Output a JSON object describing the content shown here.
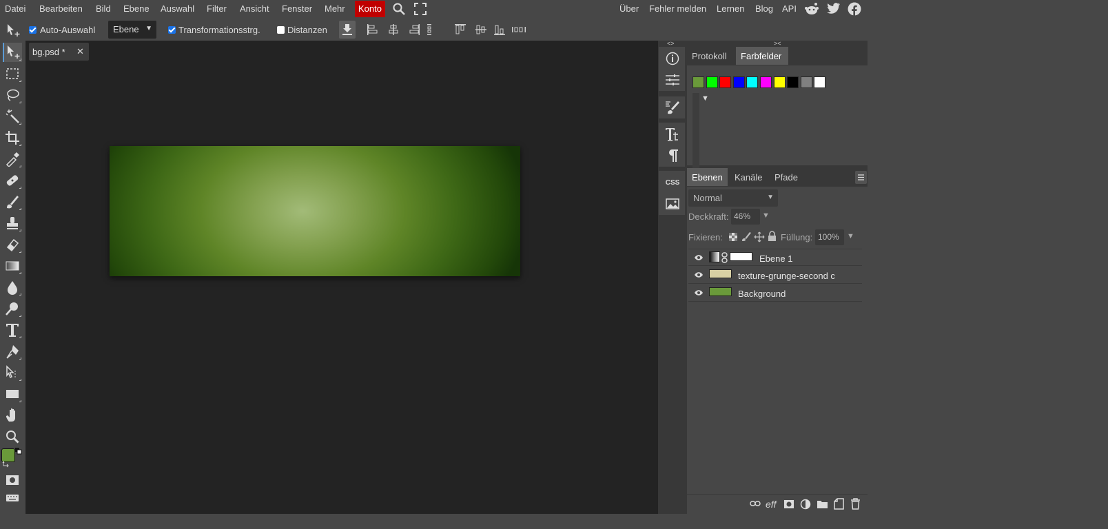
{
  "menu": {
    "items": [
      "Datei",
      "Bearbeiten",
      "Bild",
      "Ebene",
      "Auswahl",
      "Filter",
      "Ansicht",
      "Fenster",
      "Mehr"
    ],
    "konto": "Konto",
    "right": [
      "Über",
      "Fehler melden",
      "Lernen",
      "Blog",
      "API"
    ]
  },
  "options": {
    "auto_select_label": "Auto-Auswahl",
    "auto_select_checked": true,
    "target_value": "Ebene",
    "transform_label": "Transformationsstrg.",
    "transform_checked": true,
    "distances_label": "Distanzen",
    "distances_checked": false
  },
  "document": {
    "tab_title": "bg.psd *",
    "close_glyph": "✕"
  },
  "colors": {
    "foreground": "#6a9a3a",
    "background": "#ffffff",
    "konto_bg": "#c00000",
    "accent": "#5b9bd5"
  },
  "history_panel": {
    "tabs": [
      "Protokoll",
      "Farbfelder"
    ],
    "active_tab": "Farbfelder",
    "swatches": [
      "#6a9a3a",
      "#00ff00",
      "#ff0000",
      "#0000ff",
      "#00ffff",
      "#ff00ff",
      "#ffff00",
      "#000000",
      "#808080",
      "#ffffff"
    ],
    "collapse_left": "<>",
    "collapse_right": "><"
  },
  "layers_panel": {
    "tabs": [
      "Ebenen",
      "Kanäle",
      "Pfade"
    ],
    "active_tab": "Ebenen",
    "blend_mode": "Normal",
    "opacity_label": "Deckkraft:",
    "opacity_value": "46%",
    "lock_label": "Fixieren:",
    "fill_label": "Füllung:",
    "fill_value": "100%",
    "layers": [
      {
        "name": "Ebene 1",
        "thumb": "gradient-mask"
      },
      {
        "name": "texture-grunge-second c",
        "thumb": "#d8d0a4"
      },
      {
        "name": "Background",
        "thumb": "#6a9a3a"
      }
    ],
    "footer": {
      "effects_label": "eff"
    }
  },
  "mid_panel": {
    "css_label": "CSS"
  }
}
